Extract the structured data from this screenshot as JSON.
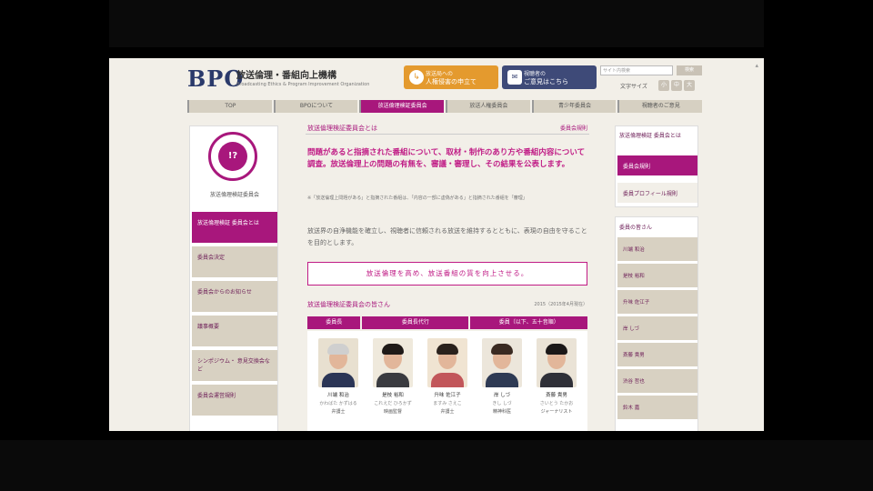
{
  "site": {
    "logo": "BPO",
    "name": "放送倫理・番組向上機構",
    "subtitle": "Broadcasting Ethics & Program Improvement Organization"
  },
  "header": {
    "orange_button": {
      "icon": "↳",
      "line1": "放送局への",
      "line2": "人権侵害の申立て"
    },
    "navy_button": {
      "icon": "✉",
      "line1": "視聴者の",
      "line2": "ご意見はこちら"
    },
    "search_placeholder": "サイト内検索",
    "search_button": "検索",
    "fontsize_label": "文字サイズ",
    "fontsize_options": [
      "小",
      "中",
      "大"
    ]
  },
  "nav": {
    "items": [
      {
        "label": "TOP",
        "active": false
      },
      {
        "label": "BPOについて",
        "active": false
      },
      {
        "label": "放送倫理検証委員会",
        "active": true
      },
      {
        "label": "放送人権委員会",
        "active": false
      },
      {
        "label": "青少年委員会",
        "active": false
      },
      {
        "label": "視聴者のご意見",
        "active": false
      }
    ]
  },
  "left_sidebar": {
    "emblem_text": "!?",
    "title": "放送倫理検証委員会",
    "items": [
      {
        "label": "放送倫理検証 委員会とは",
        "active": true
      },
      {
        "label": "委員会決定",
        "active": false
      },
      {
        "label": "委員会からのお知らせ",
        "active": false
      },
      {
        "label": "議事概要",
        "active": false
      },
      {
        "label": "シンポジウム・ 意見交換会など",
        "active": false
      },
      {
        "label": "委員会運営規則",
        "active": false
      }
    ]
  },
  "main": {
    "section_title": "放送倫理検証委員会とは",
    "section_link": "委員会規則",
    "lead": "問題があると指摘された番組について、取材・制作のあり方や番組内容について調査。放送倫理上の問題の有無を、審議・審理し、その結果を公表します。",
    "note": "※「放送倫理上問題がある」と指摘された番組は、「内容の一部に虚偽がある」と指摘された番組を「審理」",
    "body": "放送界の自浄機能を確立し、視聴者に信頼される放送を維持するとともに、表現の自由を守ることを目的とします。",
    "mission": "放送倫理を高め、放送番組の質を向上させる。",
    "members_title": "放送倫理検証委員会の皆さん",
    "members_date": "2015（2015年4月現在）",
    "roles": [
      "委員長",
      "委員長代行",
      "委員（以下、五十音順）"
    ],
    "members": [
      {
        "name": "川端 和治",
        "kana": "かわばた かずはる",
        "role": "弁護士",
        "hair": "#cfcfcf",
        "suit": "#2b3556",
        "bg": "#e8e0d0"
      },
      {
        "name": "是枝 裕和",
        "kana": "これえだ ひろかず",
        "role": "映画監督",
        "hair": "#1f1a18",
        "suit": "#3a3b40",
        "bg": "#efe9dc"
      },
      {
        "name": "升味 佐江子",
        "kana": "ますみ さえこ",
        "role": "弁護士",
        "hair": "#2a211c",
        "suit": "#c2565a",
        "bg": "#f0e4d2"
      },
      {
        "name": "岸 しづ",
        "kana": "きし しづ",
        "role": "精神科医",
        "hair": "#3a2a22",
        "suit": "#2e3a54",
        "bg": "#ece6db"
      },
      {
        "name": "斎藤 貴男",
        "kana": "さいとう たかお",
        "role": "ジャーナリスト",
        "hair": "#1b1818",
        "suit": "#2f3038",
        "bg": "#eae3d6"
      }
    ]
  },
  "right_sidebar": {
    "title": "放送倫理検証 委員会とは",
    "active_item": "委員会規則",
    "normal_item": "委員プロフィール規則",
    "members_title": "委員の皆さん",
    "member_links": [
      "川端 和治",
      "是枝 裕和",
      "升味 佐江子",
      "岸 しづ",
      "斎藤 貴男",
      "渋谷 哲也",
      "鈴木 嘉"
    ]
  },
  "colors": {
    "accent": "#a8177c",
    "accent_text": "#c01b85",
    "nav_bg": "#d6d0c2",
    "orange": "#e49a2e",
    "navy": "#3e4a78"
  }
}
